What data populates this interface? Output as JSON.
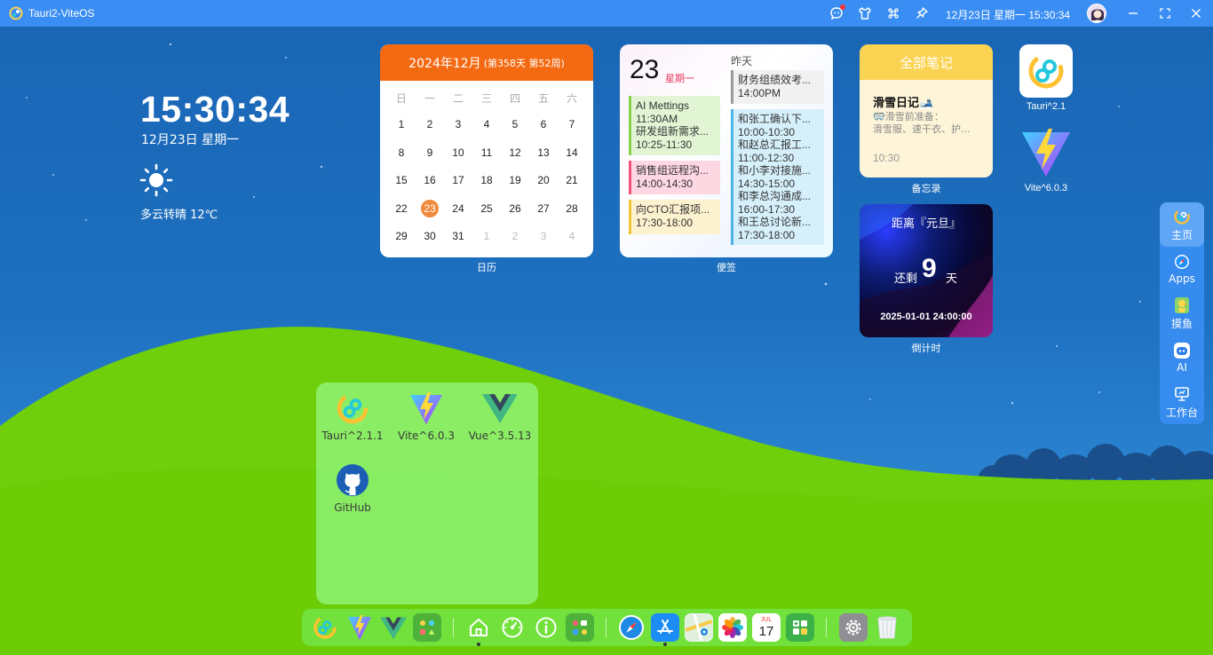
{
  "titlebar": {
    "app_title": "Tauri2-ViteOS",
    "datetime": "12月23日 星期一 15:30:34",
    "icons": [
      "chat-icon",
      "shirt-icon",
      "command-icon",
      "pin-icon"
    ],
    "window_controls": [
      "minimize-icon",
      "fullscreen-icon",
      "close-icon"
    ]
  },
  "clock": {
    "time": "15:30:34",
    "date": "12月23日 星期一",
    "weather_icon": "sun-icon",
    "weather": "多云转晴 12℃"
  },
  "calendar": {
    "month_title": "2024年12月",
    "extra": "(第358天 第52周)",
    "weekdays": [
      "日",
      "一",
      "二",
      "三",
      "四",
      "五",
      "六"
    ],
    "days": [
      [
        "1",
        "2",
        "3",
        "4",
        "5",
        "6",
        "7"
      ],
      [
        "8",
        "9",
        "10",
        "11",
        "12",
        "13",
        "14"
      ],
      [
        "15",
        "16",
        "17",
        "18",
        "19",
        "20",
        "21"
      ],
      [
        "22",
        "23",
        "24",
        "25",
        "26",
        "27",
        "28"
      ],
      [
        "29",
        "30",
        "31",
        "1",
        "2",
        "3",
        "4"
      ]
    ],
    "today": "23",
    "label": "日历"
  },
  "notes": {
    "day": "23",
    "weekday": "星期一",
    "yesterday_label": "昨天",
    "today_items": [
      {
        "text": "AI Mettings\n11:30AM\n研发组新需求...\n10:25-11:30",
        "bg": "#e1f5d4",
        "border": "#86d14e"
      },
      {
        "text": "销售组远程沟...\n14:00-14:30",
        "bg": "#fdd7e2",
        "border": "#f1527c"
      },
      {
        "text": "向CTO汇报项...\n17:30-18:00",
        "bg": "#fdf2cf",
        "border": "#f4c23a"
      }
    ],
    "yesterday_items": [
      {
        "text": "财务组绩效考...\n14:00PM",
        "bg": "#f1f1f1",
        "border": "#9a9a9a"
      },
      {
        "text": "和张工确认下...\n10:00-10:30\n和赵总汇报工...\n11:00-12:30\n和小李对接施...\n14:30-15:00\n和李总沟通成...\n16:00-17:30\n和王总讨论新...\n17:30-18:00",
        "bg": "#d6f0fb",
        "border": "#49b6e6"
      }
    ],
    "label": "便签"
  },
  "memo": {
    "header": "全部笔记",
    "title": "滑雪日记🎿",
    "lines": [
      "🥽滑雪前准备：",
      "滑雪服、速干衣、护..."
    ],
    "time": "10:30",
    "label": "备忘录"
  },
  "countdown": {
    "title": "距离『元旦』",
    "remain_prefix": "还剩",
    "days": "9",
    "unit": "天",
    "target": "2025-01-01 24:00:00",
    "label": "倒计时"
  },
  "desktop_apps": [
    {
      "label": "Tauri^2.1",
      "icon": "tauri-icon"
    },
    {
      "label": "Vite^6.0.3",
      "icon": "vite-icon"
    }
  ],
  "sidenav": [
    {
      "label": "主页",
      "icon": "tauri-icon",
      "active": true
    },
    {
      "label": "Apps",
      "icon": "safari-icon"
    },
    {
      "label": "摸鱼",
      "icon": "duck-icon"
    },
    {
      "label": "AI",
      "icon": "robot-icon"
    },
    {
      "label": "工作台",
      "icon": "monitor-icon"
    }
  ],
  "folder": {
    "apps": [
      {
        "label": "Tauri^2.1.1",
        "icon": "tauri-icon"
      },
      {
        "label": "Vite^6.0.3",
        "icon": "vite-icon"
      },
      {
        "label": "Vue^3.5.13",
        "icon": "vue-icon"
      },
      {
        "label": "GitHub",
        "icon": "github-icon"
      }
    ]
  },
  "dock": {
    "items": [
      "tauri-icon",
      "vite-icon",
      "vue-icon",
      "widgets-icon",
      "home-icon",
      "dashboard-icon",
      "info-icon",
      "apps-folder-icon",
      "safari-icon",
      "app-store-icon",
      "maps-icon",
      "photos-icon",
      "calendar-icon",
      "calculator-icon",
      "settings-icon",
      "trash-icon"
    ],
    "calendar_day": "17",
    "calendar_month": "JUL"
  },
  "colors": {
    "titlebar": "#3a8ef3",
    "calendar_head": "#f46a12",
    "memo_head": "#fbd352",
    "hill": "#6ccf08",
    "accent_red": "#e8385e"
  }
}
